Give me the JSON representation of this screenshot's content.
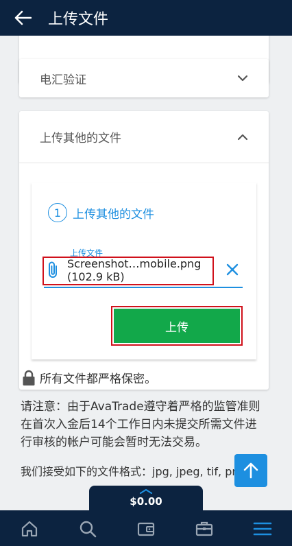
{
  "header": {
    "title": "上传文件"
  },
  "accordions": {
    "wire": {
      "label": "电汇验证"
    },
    "other": {
      "label": "上传其他的文件"
    }
  },
  "upload": {
    "step_number": "1",
    "step_label": "上传其他的文件",
    "field_label": "上传文件",
    "file_name": "Screenshot…mobile.png",
    "file_size": "(102.9 kB)",
    "button_label": "上传"
  },
  "secure_text": "所有文件都严格保密。",
  "notice_text": "请注意：由于AvaTrade遵守着严格的监管准则 在首次入金后14个工作日内未提交所需文件进行审核的帐户可能会暂时无法交易。",
  "accepted_text": "我们接受如下的文件格式：jpg, jpeg, tif, png",
  "balance": {
    "amount": "$0.00"
  },
  "colors": {
    "navy": "#0c2340",
    "blue": "#1d8fe0",
    "green": "#12a84a",
    "red_highlight": "#d0111b"
  },
  "icons": {
    "back": "arrow-left-icon",
    "chevron_down": "chevron-down-icon",
    "chevron_up": "chevron-up-icon",
    "attach": "paperclip-icon",
    "clear": "close-icon",
    "lock": "lock-icon",
    "scroll_top": "arrow-up-icon",
    "home": "home-icon",
    "search": "search-icon",
    "wallet": "wallet-icon",
    "portfolio": "briefcase-icon",
    "menu": "menu-icon"
  }
}
